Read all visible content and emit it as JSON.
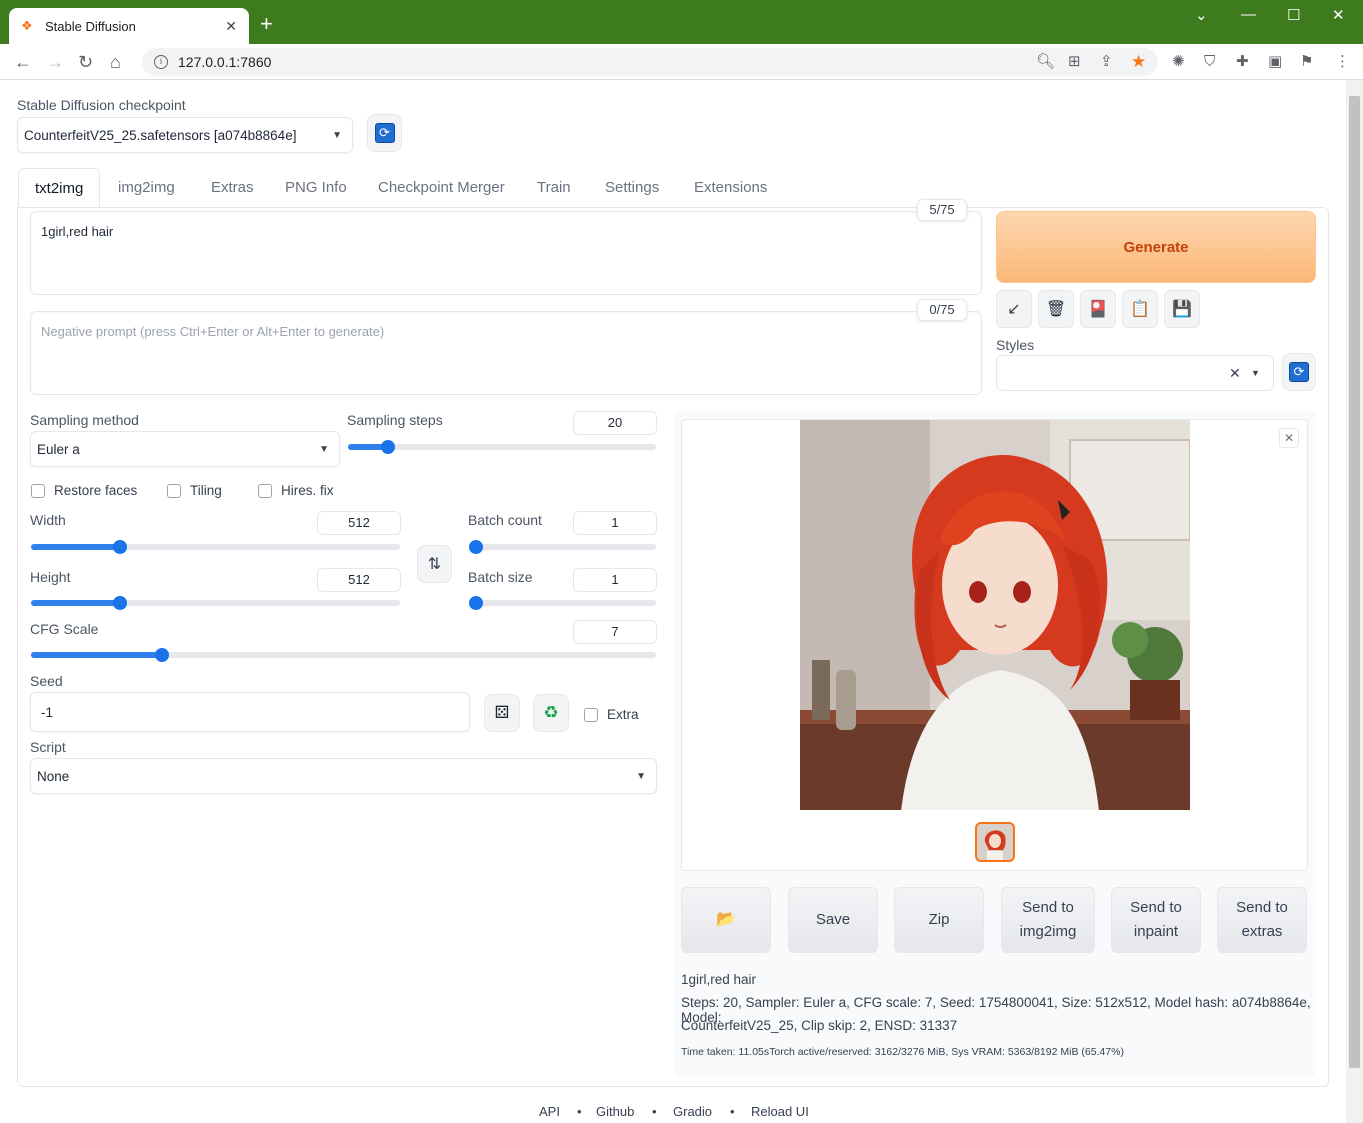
{
  "browser": {
    "tab_title": "Stable Diffusion",
    "url": "127.0.0.1:7860"
  },
  "checkpoint": {
    "label": "Stable Diffusion checkpoint",
    "value": "CounterfeitV25_25.safetensors [a074b8864e]"
  },
  "tabs": [
    {
      "label": "txt2img",
      "active": true
    },
    {
      "label": "img2img"
    },
    {
      "label": "Extras"
    },
    {
      "label": "PNG Info"
    },
    {
      "label": "Checkpoint Merger"
    },
    {
      "label": "Train"
    },
    {
      "label": "Settings"
    },
    {
      "label": "Extensions"
    }
  ],
  "prompt": {
    "value": "1girl,red hair",
    "counter": "5/75"
  },
  "negative_prompt": {
    "placeholder": "Negative prompt (press Ctrl+Enter or Alt+Enter to generate)",
    "counter": "0/75"
  },
  "generate_label": "Generate",
  "styles_label": "Styles",
  "sampling": {
    "method_label": "Sampling method",
    "method_value": "Euler a",
    "steps_label": "Sampling steps",
    "steps_value": "20"
  },
  "checks": {
    "restore_faces": "Restore faces",
    "tiling": "Tiling",
    "hires_fix": "Hires. fix",
    "extra": "Extra"
  },
  "width": {
    "label": "Width",
    "value": "512"
  },
  "height": {
    "label": "Height",
    "value": "512"
  },
  "batch_count": {
    "label": "Batch count",
    "value": "1"
  },
  "batch_size": {
    "label": "Batch size",
    "value": "1"
  },
  "cfg": {
    "label": "CFG Scale",
    "value": "7"
  },
  "seed": {
    "label": "Seed",
    "value": "-1"
  },
  "script": {
    "label": "Script",
    "value": "None"
  },
  "output_buttons": {
    "save": "Save",
    "zip": "Zip",
    "send_img2img_1": "Send to",
    "send_img2img_2": "img2img",
    "send_inpaint_1": "Send to",
    "send_inpaint_2": "inpaint",
    "send_extras_1": "Send to",
    "send_extras_2": "extras"
  },
  "output_info": {
    "prompt": "1girl,red hair",
    "params_line1": "Steps: 20, Sampler: Euler a, CFG scale: 7, Seed: 1754800041, Size: 512x512, Model hash: a074b8864e, Model:",
    "params_line2": "CounterfeitV25_25, Clip skip: 2, ENSD: 31337",
    "time": "Time taken: 11.05sTorch active/reserved: 3162/3276 MiB, Sys VRAM: 5363/8192 MiB (65.47%)"
  },
  "footer": {
    "api": "API",
    "github": "Github",
    "gradio": "Gradio",
    "reload": "Reload UI",
    "sep": "•"
  },
  "slider_levels": {
    "steps": 0.13,
    "width": 0.24,
    "height": 0.24,
    "batch_count": 0.0,
    "batch_size": 0.0,
    "cfg": 0.21
  }
}
